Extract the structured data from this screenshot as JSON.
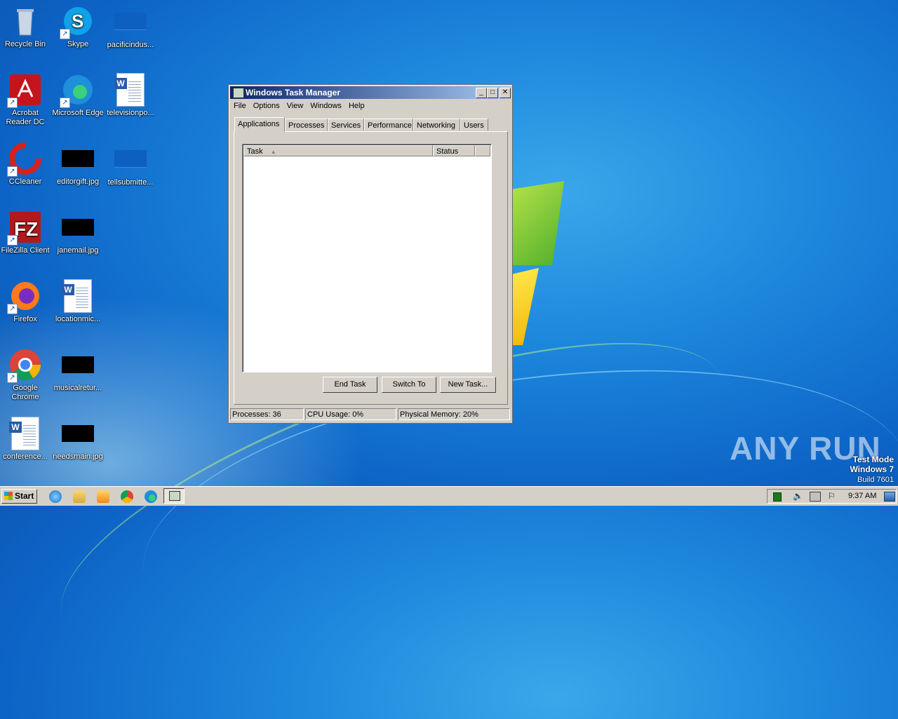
{
  "desktop": {
    "icons": [
      {
        "label": "Recycle Bin"
      },
      {
        "label": "Skype"
      },
      {
        "label": "pacificindus..."
      },
      {
        "label": "Acrobat Reader DC"
      },
      {
        "label": "Microsoft Edge"
      },
      {
        "label": "televisionpo..."
      },
      {
        "label": "CCleaner"
      },
      {
        "label": "editorgift.jpg"
      },
      {
        "label": "tellsubmitte..."
      },
      {
        "label": "FileZilla Client"
      },
      {
        "label": "janemail.jpg"
      },
      {
        "label": "Firefox"
      },
      {
        "label": "locationmic..."
      },
      {
        "label": "Google Chrome"
      },
      {
        "label": "musicalretur..."
      },
      {
        "label": "conference..."
      },
      {
        "label": "needsmain.jpg"
      }
    ],
    "watermark": {
      "brand": "ANY RUN",
      "line1": "Test Mode",
      "line2": "Windows 7",
      "line3": "Build 7601"
    }
  },
  "window": {
    "title": "Windows Task Manager",
    "menu": [
      "File",
      "Options",
      "View",
      "Windows",
      "Help"
    ],
    "tabs": [
      "Applications",
      "Processes",
      "Services",
      "Performance",
      "Networking",
      "Users"
    ],
    "active_tab": "Applications",
    "columns": [
      "Task",
      "Status"
    ],
    "buttons": {
      "end_task": "End Task",
      "switch_to": "Switch To",
      "new_task": "New Task..."
    },
    "status": {
      "processes": "Processes: 36",
      "cpu": "CPU Usage: 0%",
      "memory": "Physical Memory: 20%"
    }
  },
  "taskbar": {
    "start_label": "Start",
    "clock": "9:37 AM"
  }
}
